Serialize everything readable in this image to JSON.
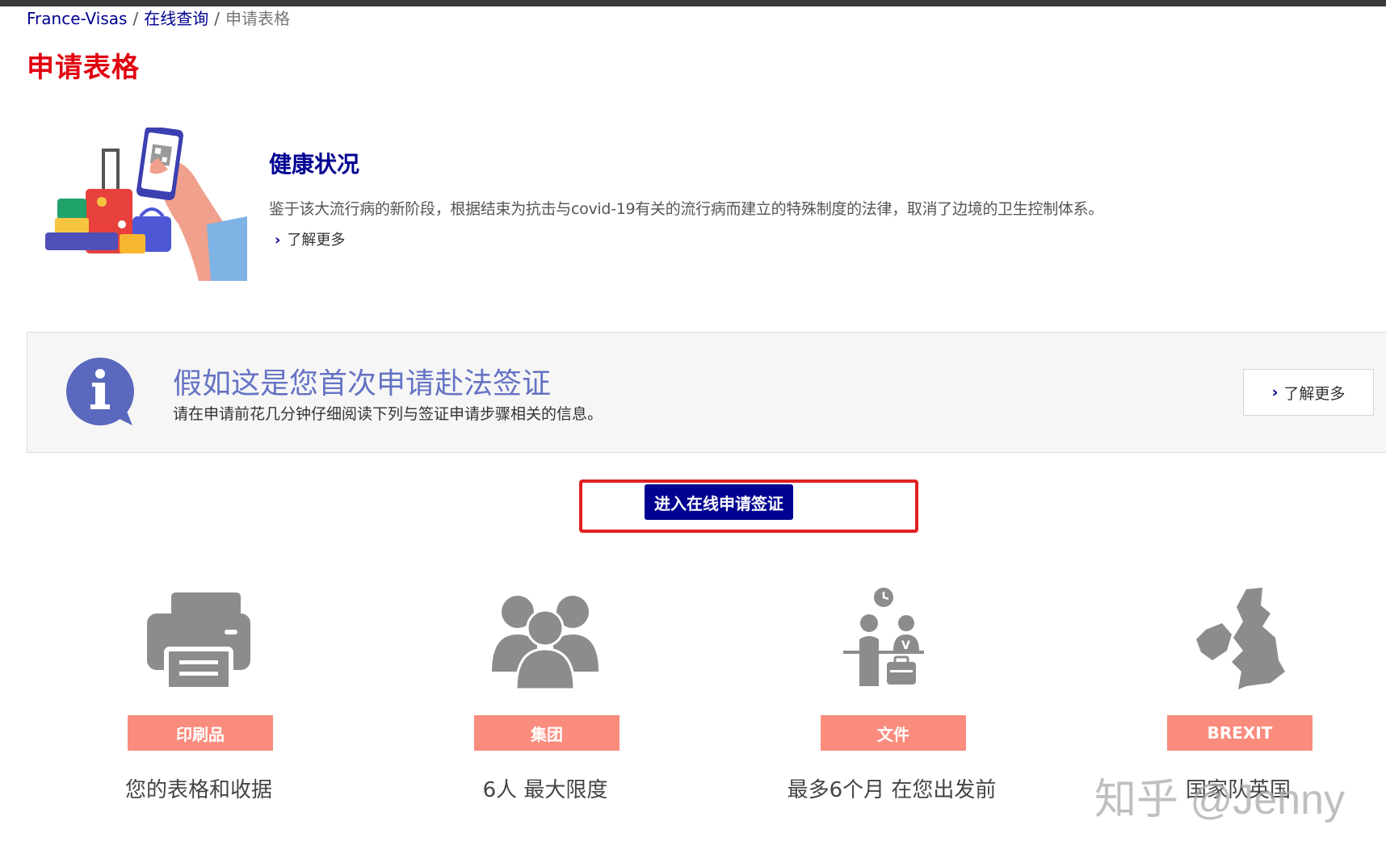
{
  "breadcrumb": {
    "home": "France-Visas",
    "separator": "/",
    "section": "在线查询",
    "current": "申请表格"
  },
  "page_title": "申请表格",
  "health": {
    "title": "健康状况",
    "text": "鉴于该大流行病的新阶段，根据结束为抗击与covid-19有关的流行病而建立的特殊制度的法律，取消了边境的卫生控制体系。",
    "link_label": "了解更多"
  },
  "info": {
    "title": "假如这是您首次申请赴法签证",
    "text": "请在申请前花几分钟仔细阅读下列与签证申请步骤相关的信息。",
    "button_label": "了解更多"
  },
  "apply_button_label": "进入在线申请签证",
  "features": [
    {
      "icon": "printer-icon",
      "label": "印刷品",
      "desc": "您的表格和收据"
    },
    {
      "icon": "group-icon",
      "label": "集团",
      "desc": "6人 最大限度"
    },
    {
      "icon": "travel-clock-icon",
      "label": "文件",
      "desc": "最多6个月 在您出发前"
    },
    {
      "icon": "uk-map-icon",
      "label": "BREXIT",
      "desc": "国家队英国"
    }
  ],
  "watermark": "知乎 @Jenny",
  "colors": {
    "title_red": "#e1000f",
    "navy": "#000091",
    "info_blue": "#6573c4",
    "label_salmon": "#f98c7d",
    "highlight_red": "#e02020",
    "icon_gray": "#8c8c8c"
  }
}
